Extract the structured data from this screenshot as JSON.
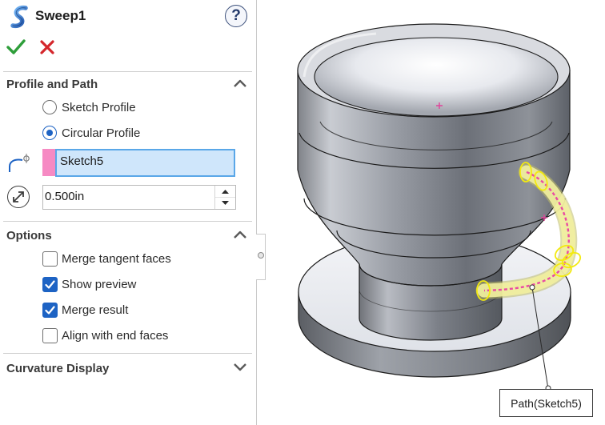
{
  "header": {
    "title": "Sweep1",
    "help_label": "?"
  },
  "profile_and_path": {
    "title": "Profile and Path",
    "options": [
      {
        "label": "Sketch Profile",
        "selected": false
      },
      {
        "label": "Circular Profile",
        "selected": true
      }
    ],
    "path_selection": "Sketch5",
    "diameter": "0.500in"
  },
  "options_group": {
    "title": "Options",
    "items": [
      {
        "label": "Merge tangent faces",
        "checked": false
      },
      {
        "label": "Show preview",
        "checked": true
      },
      {
        "label": "Merge result",
        "checked": true
      },
      {
        "label": "Align with end faces",
        "checked": false
      }
    ]
  },
  "curvature_group": {
    "title": "Curvature Display"
  },
  "viewport": {
    "path_callout": "Path(Sketch5)"
  },
  "colors": {
    "accent": "#1d63c4",
    "path_swatch": "#f68ac3",
    "selection_fill": "#cfe6fb",
    "ok_green": "#2e9e3a",
    "cancel_red": "#d4262b",
    "preview_yellow": "#f2f0a0"
  },
  "icons": {
    "feature": "sweep-feature-icon",
    "ok": "checkmark-icon",
    "cancel": "x-icon",
    "help": "help-icon",
    "path": "sweep-path-icon",
    "diameter": "diameter-icon"
  }
}
